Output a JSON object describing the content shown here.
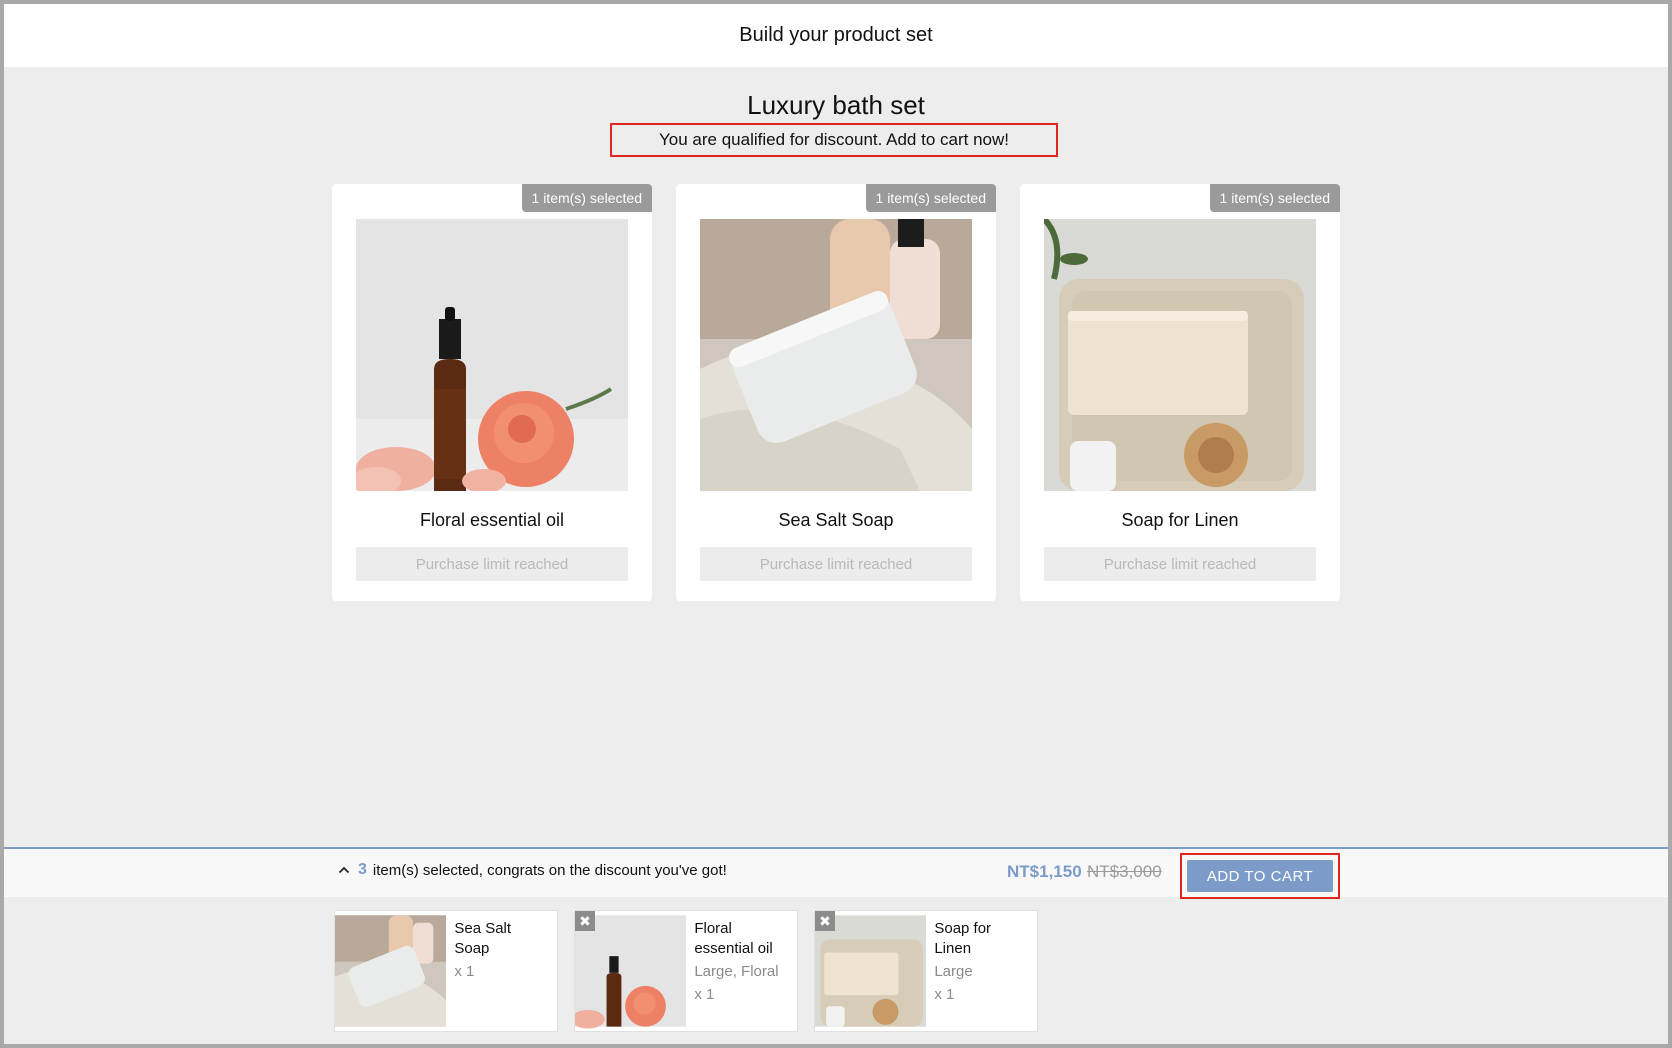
{
  "header": {
    "title": "Build your product set"
  },
  "set": {
    "title": "Luxury bath set",
    "discount_message": "You are qualified for discount. Add to cart now!"
  },
  "products": [
    {
      "badge": "1 item(s) selected",
      "name": "Floral essential oil",
      "button": "Purchase limit reached",
      "image": "essential-oil-bottle-with-rose"
    },
    {
      "badge": "1 item(s) selected",
      "name": "Sea Salt Soap",
      "button": "Purchase limit reached",
      "image": "white-soap-bar-on-towel"
    },
    {
      "badge": "1 item(s) selected",
      "name": "Soap for Linen",
      "button": "Purchase limit reached",
      "image": "beige-soap-on-tray-with-brush"
    }
  ],
  "footer": {
    "chevron": "^",
    "count": "3",
    "summary_text": "item(s) selected, congrats on the discount you've got!",
    "price_discounted": "NT$1,150",
    "price_original": "NT$3,000",
    "cart_button": "ADD TO CART"
  },
  "selected_items": [
    {
      "name": "Sea Salt Soap",
      "variant": "",
      "qty": "x 1",
      "removable": false,
      "image": "white-soap-bar-on-towel"
    },
    {
      "name": "Floral essential oil",
      "variant": "Large, Floral",
      "qty": "x 1",
      "removable": true,
      "image": "essential-oil-bottle-with-rose"
    },
    {
      "name": "Soap for Linen",
      "variant": "Large",
      "qty": "x 1",
      "removable": true,
      "image": "beige-soap-on-tray-with-brush"
    }
  ],
  "colors": {
    "accent": "#7d9bc9",
    "highlight_outline": "#e2261b",
    "badge_bg": "#9a9a9a",
    "page_bg": "#ededed"
  },
  "icons": {
    "remove": "x",
    "chevron": "chevron-up-icon"
  }
}
